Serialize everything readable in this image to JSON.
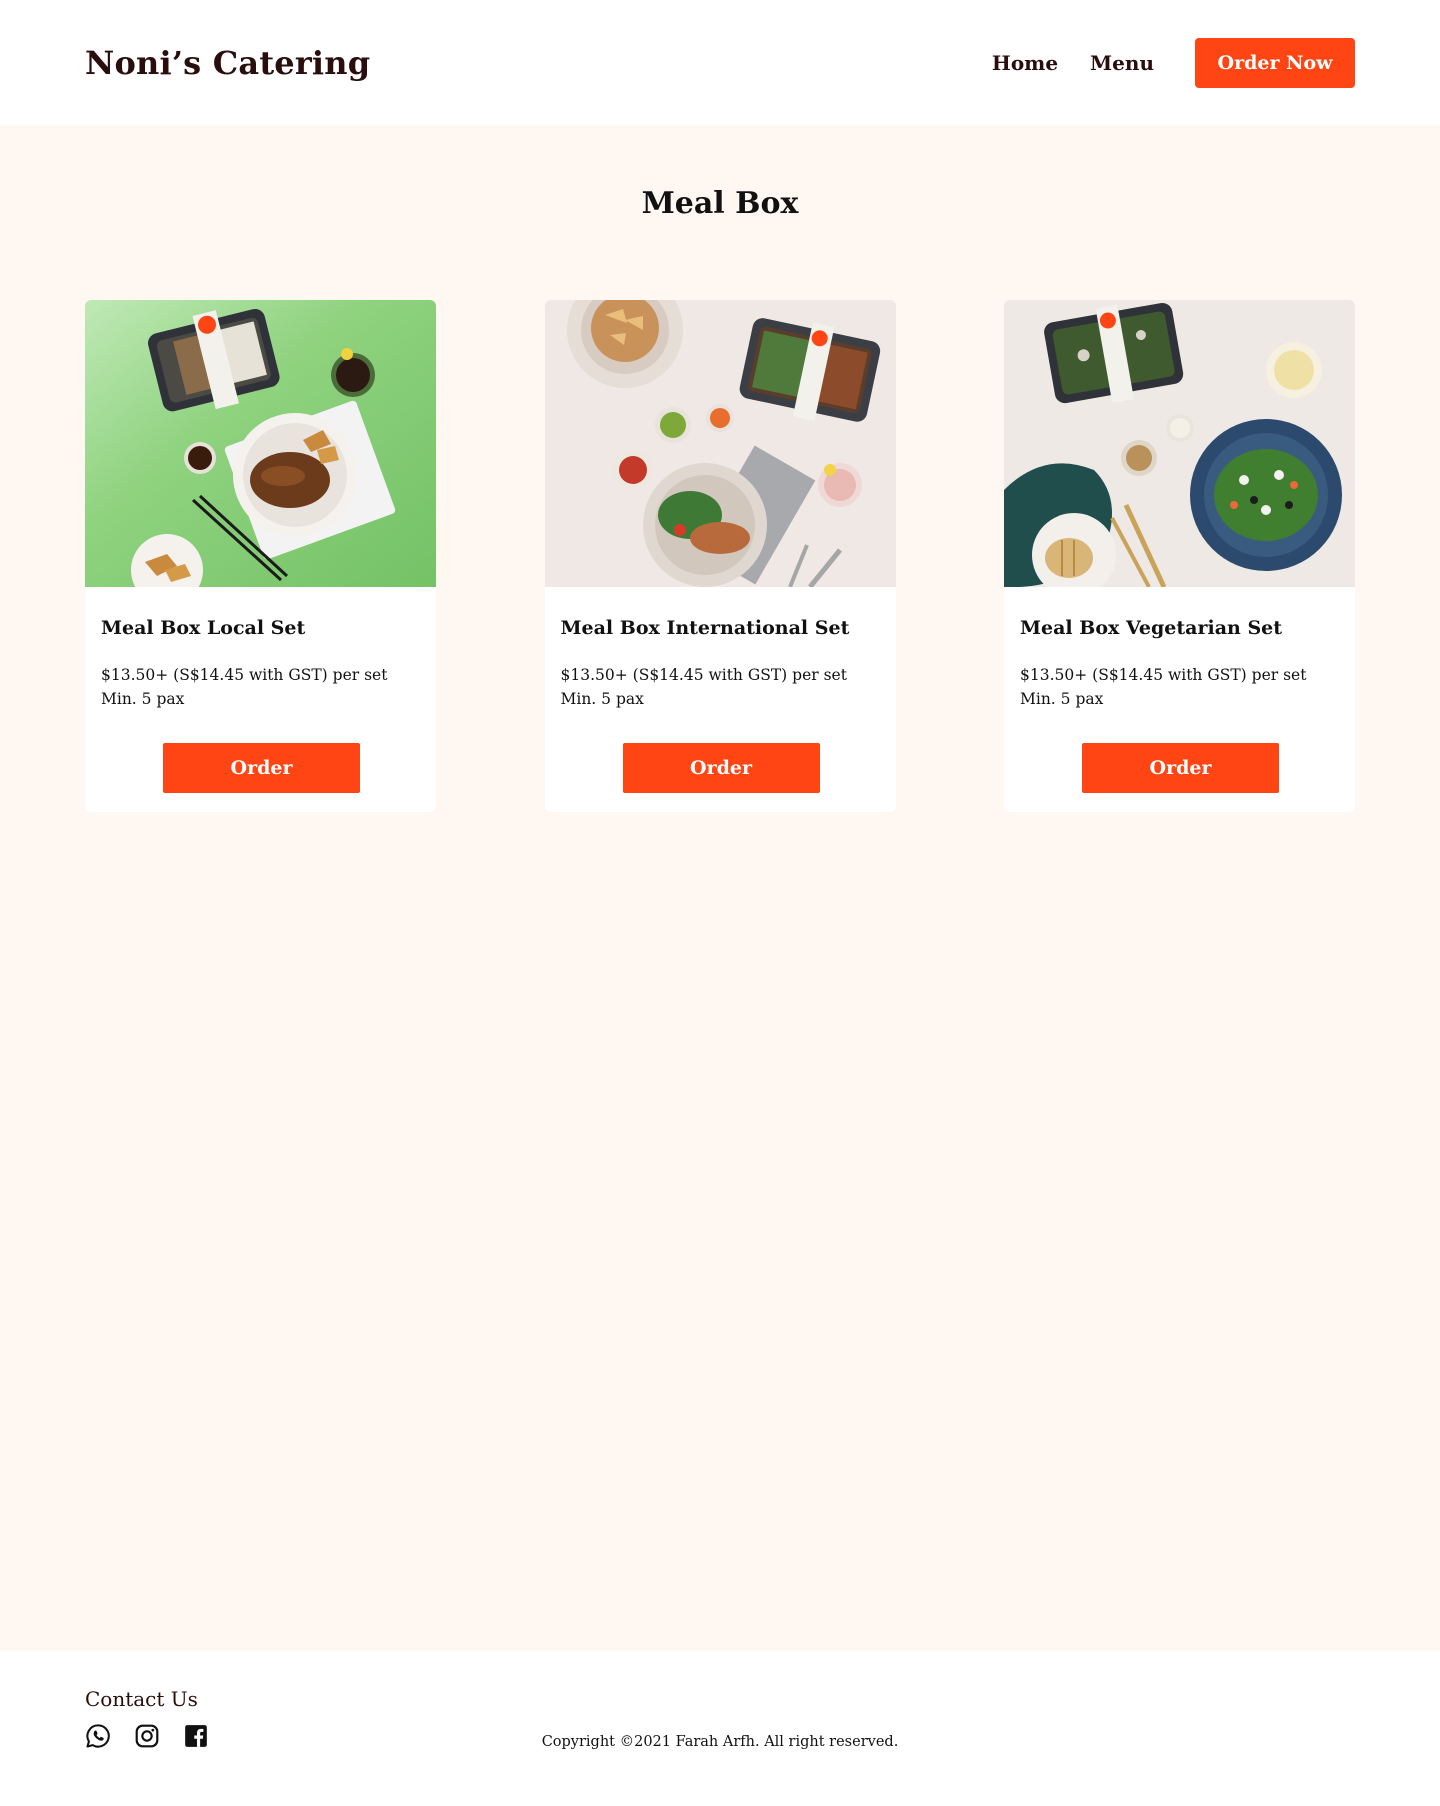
{
  "header": {
    "brand": "Noni’s Catering",
    "nav": {
      "home": "Home",
      "menu": "Menu"
    },
    "order_now": "Order Now"
  },
  "main": {
    "title": "Meal Box",
    "cards": [
      {
        "title": "Meal Box Local Set",
        "price": "$13.50+ (S$14.45 with GST) per set",
        "min": "Min. 5 pax",
        "button": "Order"
      },
      {
        "title": "Meal Box International Set",
        "price": "$13.50+ (S$14.45 with GST) per set",
        "min": "Min. 5 pax",
        "button": "Order"
      },
      {
        "title": "Meal Box Vegetarian Set",
        "price": "$13.50+ (S$14.45 with GST) per set",
        "min": "Min. 5 pax",
        "button": "Order"
      }
    ]
  },
  "footer": {
    "contact_title": "Contact Us",
    "socials": [
      "whatsapp-icon",
      "instagram-icon",
      "facebook-icon"
    ],
    "copyright": "Copyright ©2021 Farah Arfh. All right reserved."
  },
  "colors": {
    "accent": "#ff4513",
    "brand_text": "#2a0d0d",
    "page_bg": "#fff7f2"
  }
}
